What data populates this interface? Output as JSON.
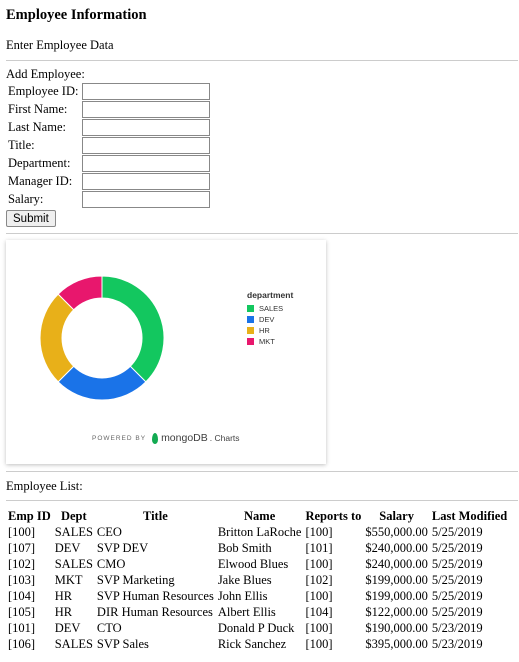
{
  "header": {
    "title": "Employee Information",
    "subtitle": "Enter Employee Data"
  },
  "form": {
    "heading": "Add Employee:",
    "fields": [
      {
        "label": "Employee ID:",
        "value": ""
      },
      {
        "label": "First Name:",
        "value": ""
      },
      {
        "label": "Last Name:",
        "value": ""
      },
      {
        "label": "Title:",
        "value": ""
      },
      {
        "label": "Department:",
        "value": ""
      },
      {
        "label": "Manager ID:",
        "value": ""
      },
      {
        "label": "Salary:",
        "value": ""
      }
    ],
    "submit_label": "Submit"
  },
  "chart_data": {
    "type": "pie",
    "legend_title": "department",
    "legend_position": "right",
    "slices": [
      {
        "name": "SALES",
        "value": 3,
        "color": "#13c75f"
      },
      {
        "name": "DEV",
        "value": 2,
        "color": "#1a73e8"
      },
      {
        "name": "HR",
        "value": 2,
        "color": "#e8b019"
      },
      {
        "name": "MKT",
        "value": 1,
        "color": "#e8176d"
      }
    ],
    "powered_by": "POWERED BY",
    "brand": "mongoDB",
    "brand_suffix": ". Charts"
  },
  "employee_list": {
    "title": "Employee List:",
    "columns": [
      "Emp ID",
      "Dept",
      "Title",
      "Name",
      "Reports to",
      "Salary",
      "Last Modified"
    ],
    "rows": [
      [
        "[100]",
        "SALES",
        "CEO",
        "Britton LaRoche",
        "[100]",
        "$550,000.00",
        "5/25/2019"
      ],
      [
        "[107]",
        "DEV",
        "SVP DEV",
        "Bob Smith",
        "[101]",
        "$240,000.00",
        "5/25/2019"
      ],
      [
        "[102]",
        "SALES",
        "CMO",
        "Elwood Blues",
        "[100]",
        "$240,000.00",
        "5/25/2019"
      ],
      [
        "[103]",
        "MKT",
        "SVP Marketing",
        "Jake Blues",
        "[102]",
        "$199,000.00",
        "5/25/2019"
      ],
      [
        "[104]",
        "HR",
        "SVP Human Resources",
        "John Ellis",
        "[100]",
        "$199,000.00",
        "5/25/2019"
      ],
      [
        "[105]",
        "HR",
        "DIR Human Resources",
        "Albert Ellis",
        "[104]",
        "$122,000.00",
        "5/25/2019"
      ],
      [
        "[101]",
        "DEV",
        "CTO",
        "Donald P Duck",
        "[100]",
        "$190,000.00",
        "5/23/2019"
      ],
      [
        "[106]",
        "SALES",
        "SVP Sales",
        "Rick Sanchez",
        "[100]",
        "$395,000.00",
        "5/23/2019"
      ]
    ]
  }
}
